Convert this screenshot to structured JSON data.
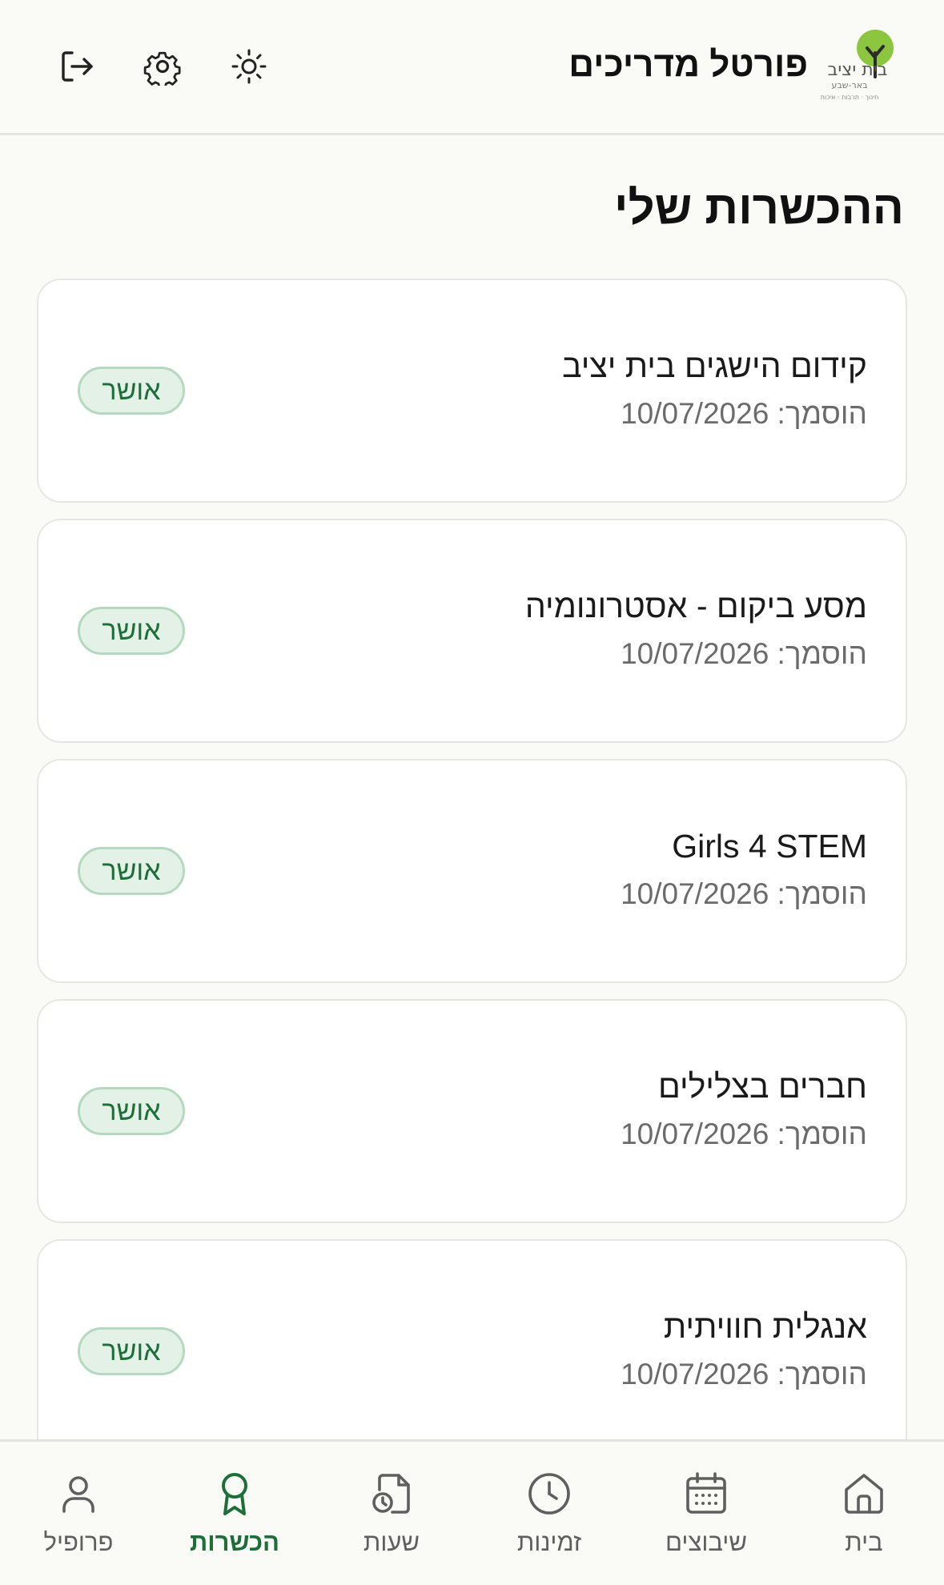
{
  "header": {
    "app_title": "פורטל מדריכים",
    "logo_text": "בית יציב",
    "logo_subtext": "באר-שבע",
    "logo_tagline": "חינוך · תרבות · איכות",
    "icons": [
      "sun-icon",
      "gear-icon",
      "logout-icon"
    ]
  },
  "page": {
    "title": "ההכשרות שלי"
  },
  "trainings": [
    {
      "name": "קידום הישגים בית יציב",
      "date": "הוסמך: 10/07/2026",
      "status": "אושר"
    },
    {
      "name": "מסע ביקום - אסטרונומיה",
      "date": "הוסמך: 10/07/2026",
      "status": "אושר"
    },
    {
      "name": "Girls 4 STEM",
      "date": "הוסמך: 10/07/2026",
      "status": "אושר"
    },
    {
      "name": "חברים בצלילים",
      "date": "הוסמך: 10/07/2026",
      "status": "אושר"
    },
    {
      "name": "אנגלית חוויתית",
      "date": "הוסמך: 10/07/2026",
      "status": "אושר"
    }
  ],
  "nav": [
    {
      "label": "פרופיל",
      "icon": "user-icon",
      "active": false
    },
    {
      "label": "הכשרות",
      "icon": "award-icon",
      "active": true
    },
    {
      "label": "שעות",
      "icon": "file-clock-icon",
      "active": false
    },
    {
      "label": "זמינות",
      "icon": "clock-icon",
      "active": false
    },
    {
      "label": "שיבוצים",
      "icon": "calendar-icon",
      "active": false
    },
    {
      "label": "בית",
      "icon": "home-icon",
      "active": false
    }
  ],
  "colors": {
    "accent": "#1e6e3a",
    "badge_bg": "#e3f1e6",
    "badge_border": "#b5d9be",
    "background": "#fafaf6"
  }
}
